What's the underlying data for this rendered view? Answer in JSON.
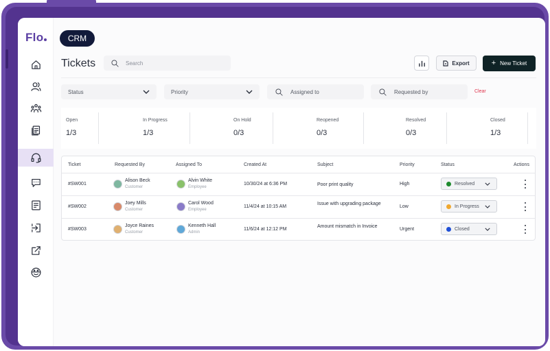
{
  "app": {
    "logo": "Flo",
    "module_pill": "CRM",
    "page_title": "Tickets"
  },
  "sidebar": {
    "items": [
      {
        "icon": "home-icon",
        "active": false
      },
      {
        "icon": "users-icon",
        "active": false
      },
      {
        "icon": "team-icon",
        "active": false
      },
      {
        "icon": "documents-icon",
        "active": false
      },
      {
        "icon": "headset-icon",
        "active": true
      },
      {
        "icon": "chat-icon",
        "active": false
      },
      {
        "icon": "list-icon",
        "active": false
      },
      {
        "icon": "login-icon",
        "active": false
      },
      {
        "icon": "external-link-icon",
        "active": false
      },
      {
        "icon": "emoji-icon",
        "active": false
      }
    ]
  },
  "toolbar": {
    "search_placeholder": "Search",
    "export_label": "Export",
    "new_ticket_label": "New Ticket"
  },
  "filters": {
    "status": "Status",
    "priority": "Priority",
    "assigned_to": "Assigned to",
    "requested_by": "Requested by",
    "clear": "Clear"
  },
  "stats": [
    {
      "label": "Open",
      "value": "1/3"
    },
    {
      "label": "In Progress",
      "value": "1/3"
    },
    {
      "label": "On Hold",
      "value": "0/3"
    },
    {
      "label": "Reopened",
      "value": "0/3"
    },
    {
      "label": "Resolved",
      "value": "0/3"
    },
    {
      "label": "Closed",
      "value": "1/3"
    }
  ],
  "table": {
    "columns": [
      "Ticket",
      "Requested By",
      "Assigned To",
      "Created At",
      "Subject",
      "Priority",
      "Status",
      "Actions"
    ],
    "rows": [
      {
        "ticket": "#SW001",
        "requested_by": {
          "name": "Alison Beck",
          "role": "Customer"
        },
        "assigned_to": {
          "name": "Alvin White",
          "role": "Employee"
        },
        "created_at": "10/30/24 at 6:36 PM",
        "subject": "Poor print quality",
        "priority": "High",
        "status": "Resolved",
        "status_color": "#1f8a2e"
      },
      {
        "ticket": "#SW002",
        "requested_by": {
          "name": "Joey Mills",
          "role": "Customer"
        },
        "assigned_to": {
          "name": "Carol Wood",
          "role": "Employee"
        },
        "created_at": "11/4/24 at 10:15 AM",
        "subject": "Issue with upgrading package",
        "priority": "Low",
        "status": "In Progress",
        "status_color": "#f0a830"
      },
      {
        "ticket": "#SW003",
        "requested_by": {
          "name": "Joyce Raines",
          "role": "Customer"
        },
        "assigned_to": {
          "name": "Kenneth Hall",
          "role": "Admin"
        },
        "created_at": "11/6/24 at 12:12 PM",
        "subject": "Amount mismatch in Invoice",
        "priority": "Urgent",
        "status": "Closed",
        "status_color": "#1f4fd6"
      }
    ]
  }
}
